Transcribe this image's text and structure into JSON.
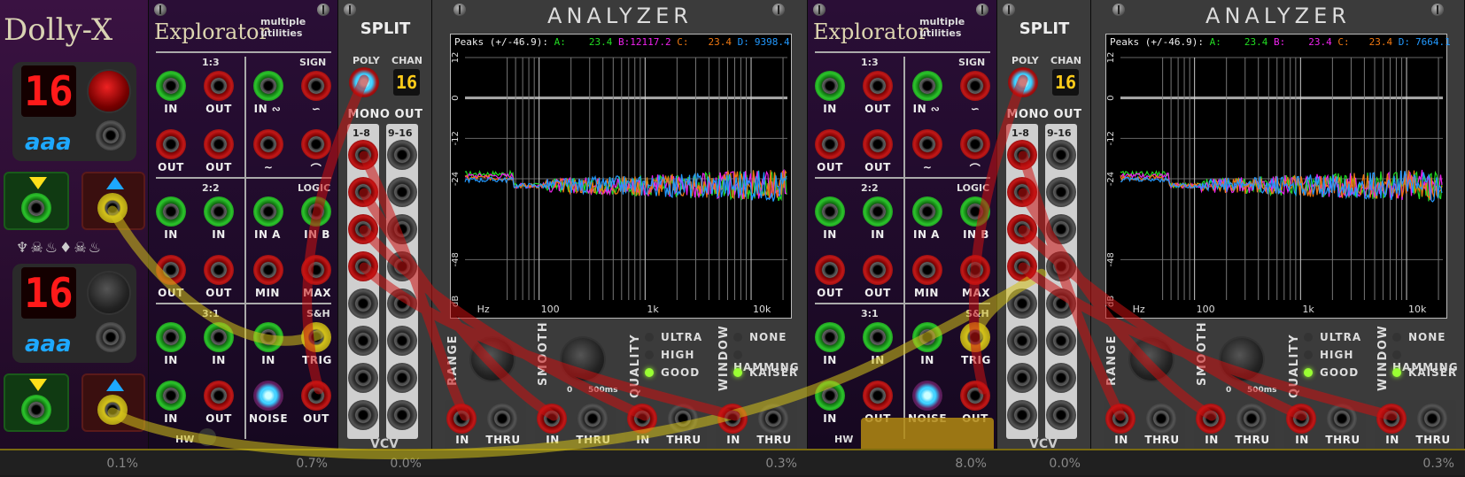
{
  "dolly": {
    "title": "Dolly-X",
    "display1": "16",
    "display2": "16",
    "text1": "aaa",
    "text2": "aaa",
    "glyphs": "♆☠♨♦☠♨",
    "cpu": "0.1%"
  },
  "explorer1": {
    "title": "Explorator",
    "subtitle": "multiple utilities",
    "sections": [
      "1:3",
      "SIGN",
      "2:2",
      "LOGIC",
      "3:1",
      "S&H"
    ],
    "labels": {
      "r1": [
        "IN",
        "OUT",
        "IN ∾",
        "∽"
      ],
      "r2": [
        "OUT",
        "OUT",
        "∼",
        "⌒"
      ],
      "r3": [
        "IN",
        "IN",
        "IN A",
        "IN B"
      ],
      "r4": [
        "OUT",
        "OUT",
        "MIN",
        "MAX"
      ],
      "r5": [
        "IN",
        "IN",
        "IN",
        "TRIG"
      ],
      "r6": [
        "IN",
        "OUT",
        "NOISE",
        "OUT"
      ]
    },
    "hw": "HW",
    "cpu": "0.7%"
  },
  "split1": {
    "title": "SPLIT",
    "poly": "POLY",
    "chan": "CHAN",
    "chan_value": "16",
    "mono_out": "MONO OUT",
    "col1": "1-8",
    "col2": "9-16",
    "brand": "VCV",
    "cpu": "0.0%"
  },
  "analyzer1": {
    "title": "ANALYZER",
    "peaks_label": "Peaks (+/-46.9):",
    "peaks": [
      {
        "name": "A:",
        "value": "23.4",
        "color": "#22dd22"
      },
      {
        "name": "B:",
        "value": "12117.2",
        "color": "#ee22ee"
      },
      {
        "name": "C:",
        "value": "23.4",
        "color": "#ee7711"
      },
      {
        "name": "D:",
        "value": "9398.4",
        "color": "#2299ff"
      }
    ],
    "y_ticks": [
      "12",
      "0",
      "-12",
      "-24",
      "-48",
      "dB"
    ],
    "x_ticks": [
      "Hz",
      "100",
      "1k",
      "10k"
    ],
    "controls": {
      "range": "RANGE",
      "smooth": "SMOOTH",
      "smooth_min": "0",
      "smooth_max": "500ms",
      "quality": "QUALITY",
      "quality_opts": [
        "ULTRA",
        "HIGH",
        "GOOD"
      ],
      "quality_sel": 2,
      "window": "WINDOW",
      "window_opts": [
        "NONE",
        "HAMMING",
        "KAISER"
      ],
      "window_sel": 2
    },
    "io": [
      "IN",
      "THRU",
      "IN",
      "THRU",
      "IN",
      "THRU",
      "IN",
      "THRU"
    ],
    "cpu": "0.3%"
  },
  "explorer2": {
    "title": "Explorator",
    "subtitle": "multiple utilities",
    "cpu": "8.0%"
  },
  "split2": {
    "title": "SPLIT",
    "poly": "POLY",
    "chan": "CHAN",
    "chan_value": "16",
    "mono_out": "MONO OUT",
    "col1": "1-8",
    "col2": "9-16",
    "brand": "VCV",
    "cpu": "0.0%"
  },
  "analyzer2": {
    "title": "ANALYZER",
    "peaks_label": "Peaks (+/-46.9):",
    "peaks": [
      {
        "name": "A:",
        "value": "23.4",
        "color": "#22dd22"
      },
      {
        "name": "B:",
        "value": "23.4",
        "color": "#ee22ee"
      },
      {
        "name": "C:",
        "value": "23.4",
        "color": "#ee7711"
      },
      {
        "name": "D:",
        "value": "7664.1",
        "color": "#2299ff"
      }
    ],
    "cpu": "0.3%"
  },
  "colors": {
    "cable_red": "#cc1111",
    "cable_yellow": "#d4c21a",
    "led_blue": "#33ccff"
  }
}
